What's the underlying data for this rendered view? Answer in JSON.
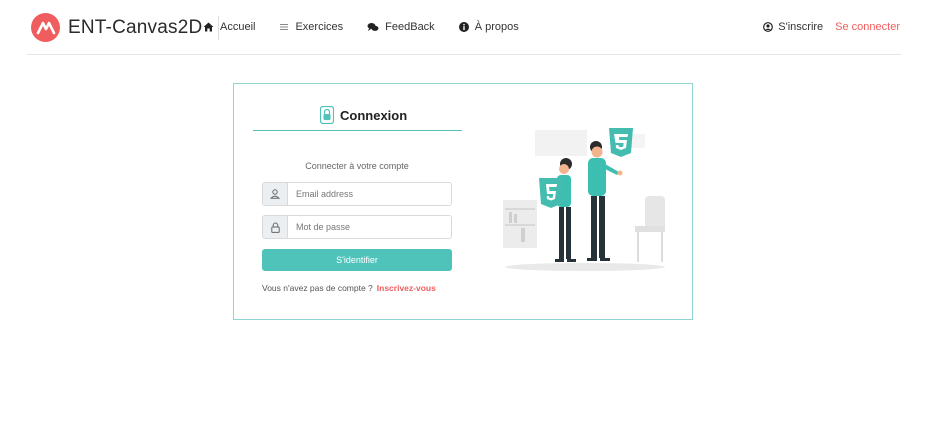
{
  "brand": {
    "name": "ENT-Canvas2D",
    "logo_icon": "logo-icon",
    "accent": "#f05d5e"
  },
  "nav": {
    "items": [
      {
        "label": "Accueil",
        "icon": "home-icon"
      },
      {
        "label": "Exercices",
        "icon": "list-icon"
      },
      {
        "label": "FeedBack",
        "icon": "comments-icon"
      },
      {
        "label": "À propos",
        "icon": "info-icon"
      }
    ],
    "signup_label": "S'inscrire",
    "login_label": "Se connecter"
  },
  "login": {
    "title": "Connexion",
    "subtitle": "Connecter à votre compte",
    "email_placeholder": "Email address",
    "password_placeholder": "Mot de passe",
    "submit_label": "S'identifier",
    "no_account_text": "Vous n'avez pas de compte ?",
    "register_link": "Inscrivez-vous"
  },
  "colors": {
    "primary": "#4fc3ba",
    "accent": "#f05d5e",
    "border": "#8fd4d1"
  }
}
